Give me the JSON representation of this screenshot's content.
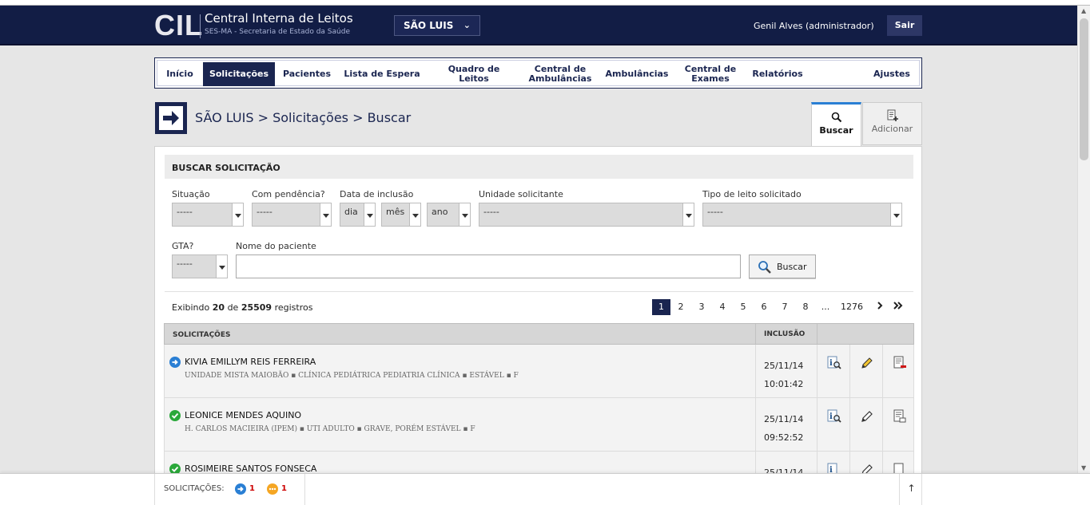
{
  "app": {
    "logo_mark": "CIL",
    "title": "Central Interna de Leitos",
    "subtitle": "SES-MA - Secretaria de Estado da Saúde",
    "city": "SÃO LUIS",
    "user": "Genil Alves (administrador)",
    "logout": "Sair"
  },
  "nav": [
    {
      "label": "Início"
    },
    {
      "label": "Solicitações",
      "active": true
    },
    {
      "label": "Pacientes"
    },
    {
      "label": "Lista de Espera"
    },
    {
      "label": "Quadro de Leitos"
    },
    {
      "label": "Central de Ambulâncias"
    },
    {
      "label": "Ambulâncias"
    },
    {
      "label": "Central de Exames"
    },
    {
      "label": "Relatórios"
    },
    {
      "label": "Ajustes"
    }
  ],
  "breadcrumb": "SÃO LUIS > Solicitações > Buscar",
  "tabs": {
    "search": "Buscar",
    "add": "Adicionar"
  },
  "filters": {
    "section_title": "BUSCAR SOLICITAÇÃO",
    "situacao": {
      "label": "Situação",
      "value": "-----"
    },
    "pendencia": {
      "label": "Com pendência?",
      "value": "-----"
    },
    "data": {
      "label": "Data de inclusão",
      "day": "dia",
      "month": "mês",
      "year": "ano"
    },
    "unidade": {
      "label": "Unidade solicitante",
      "value": "-----"
    },
    "tipo_leito": {
      "label": "Tipo de leito solicitado",
      "value": "-----"
    },
    "gta": {
      "label": "GTA?",
      "value": "-----"
    },
    "nome": {
      "label": "Nome do paciente",
      "value": ""
    },
    "search_button": "Buscar"
  },
  "results": {
    "prefix": "Exibindo",
    "shown": "20",
    "middle": "de",
    "total": "25509",
    "suffix": "registros",
    "pages": [
      "1",
      "2",
      "3",
      "4",
      "5",
      "6",
      "7",
      "8",
      "...",
      "1276"
    ],
    "current_page": "1",
    "next_icon": "chevron-right-icon",
    "last_icon": "double-chevron-right-icon"
  },
  "table": {
    "col_requests": "SOLICITAÇÕES",
    "col_inclusion": "INCLUSÃO",
    "rows": [
      {
        "status": "arrow-right-circle-icon",
        "status_color": "#2a7fd4",
        "name": "KIVIA EMILLYM REIS FERREIRA",
        "details": "UNIDADE MISTA MAIOBÃO  ▪  CLÍNICA PEDIÁTRICA PEDIATRIA CLÍNICA  ▪  ESTÁVEL  ▪  F",
        "date": "25/11/14",
        "time": "10:01:42"
      },
      {
        "status": "check-circle-icon",
        "status_color": "#2aa83a",
        "name": "LEONICE MENDES AQUINO",
        "details": "H. CARLOS MACIEIRA (IPEM)  ▪  UTI ADULTO  ▪  GRAVE, PORÉM ESTÁVEL  ▪  F",
        "date": "25/11/14",
        "time": "09:52:52"
      },
      {
        "status": "check-circle-icon",
        "status_color": "#2aa83a",
        "name": "ROSIMEIRE SANTOS FONSECA",
        "details": "",
        "date": "25/11/14",
        "time": ""
      }
    ]
  },
  "footer": {
    "label": "SOLICITAÇÕES:",
    "pending_count": "1",
    "warning_count": "1",
    "top_icon": "arrow-up-icon"
  }
}
